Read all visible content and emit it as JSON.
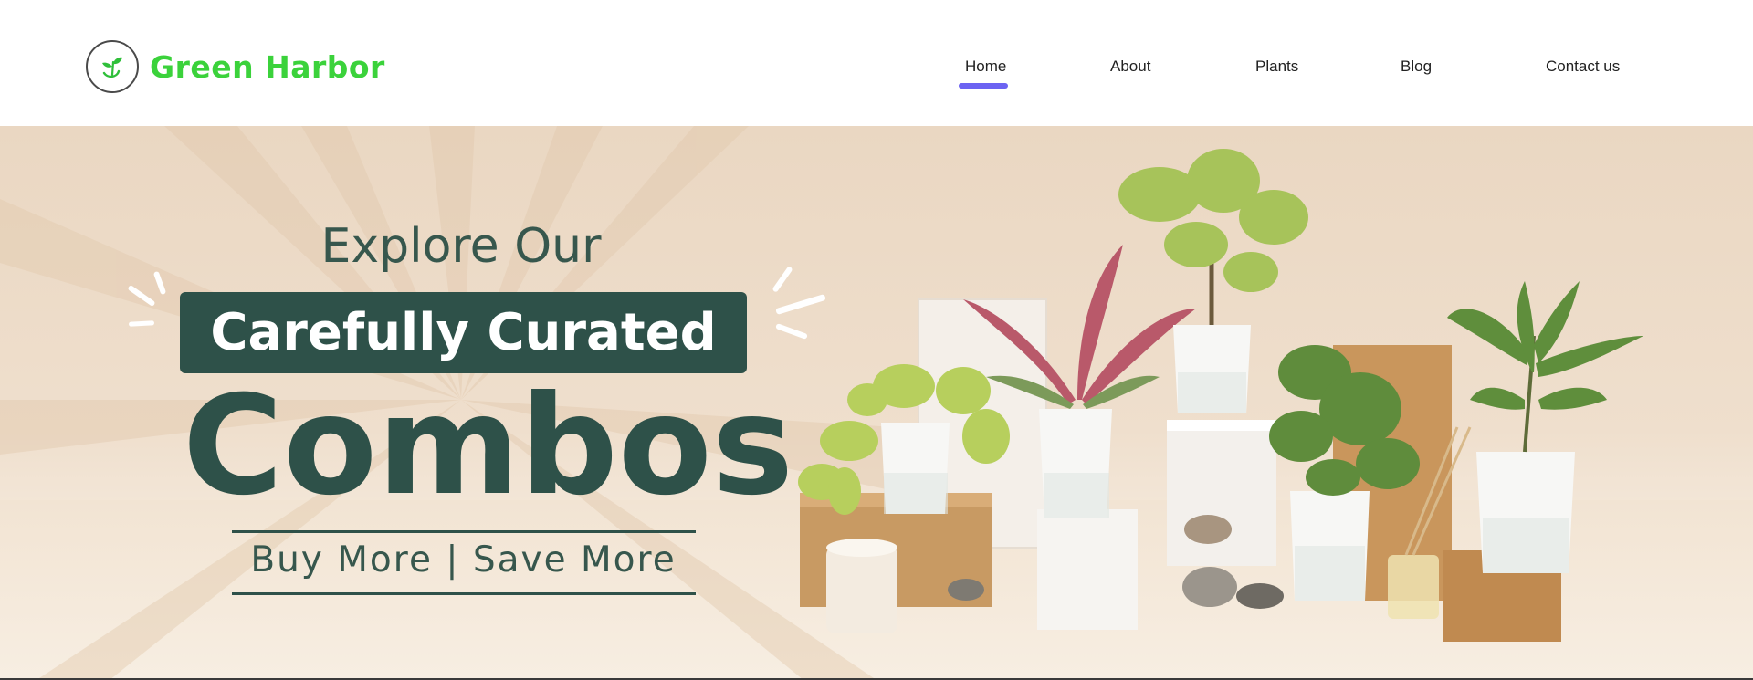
{
  "brand": {
    "name": "Green Harbor",
    "logo_icon": "leaf-sprout-icon",
    "color": "#3bd23b"
  },
  "nav": {
    "items": [
      {
        "label": "Home",
        "active": true
      },
      {
        "label": "About",
        "active": false
      },
      {
        "label": "Plants",
        "active": false
      },
      {
        "label": "Blog",
        "active": false
      },
      {
        "label": "Contact us",
        "active": false
      }
    ],
    "active_indicator_color": "#6c63f2"
  },
  "hero": {
    "line1": "Explore Our",
    "line2": "Carefully Curated",
    "line3": "Combos",
    "tagline": "Buy More | Save More",
    "accent_color": "#2e5149",
    "image": "potted-plants-display"
  }
}
